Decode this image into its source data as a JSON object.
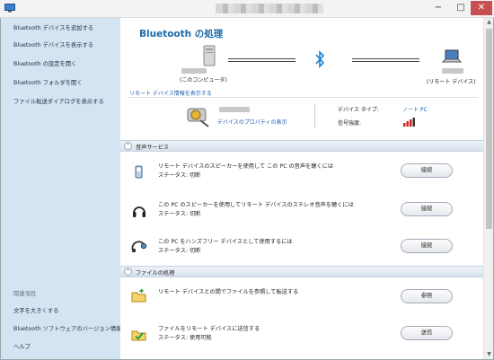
{
  "window": {
    "min_label": "−",
    "max_label": "□",
    "close_label": "✕"
  },
  "sidebar": {
    "tasks": [
      {
        "label": "Bluetooth デバイスを追加する"
      },
      {
        "label": "Bluetooth デバイスを表示する"
      },
      {
        "label": "Bluetooth の設定を開く"
      },
      {
        "label": "Bluetooth フォルダを開く"
      },
      {
        "label": "ファイル転送ダイアログを表示する"
      }
    ],
    "related_heading": "関連項目",
    "related": [
      {
        "label": "文字を大きくする"
      },
      {
        "label": "Bluetooth ソフトウェアのバージョン情報"
      },
      {
        "label": "ヘルプ"
      }
    ]
  },
  "main": {
    "title": "Bluetooth の処理",
    "this_computer_label": "(このコンピュータ)",
    "remote_device_label": "(リモート デバイス)",
    "remote_info_link": "リモート デバイス情報を表示する",
    "device_props_link": "デバイスのプロパティの表示",
    "device_type_label": "デバイス タイプ:",
    "device_type_value": "ノート PC",
    "signal_label": "信号強度:",
    "sections": [
      {
        "title": "音声サービス",
        "services": [
          {
            "text": "リモート デバイスのスピーカーを使用して この PC の音声を聴くには",
            "status": "ステータス:  切断",
            "button": "接続",
            "icon": "speaker-phone-icon"
          },
          {
            "text": "この PC のスピーカーを使用してリモート デバイスのステレオ音声を聴くには",
            "status": "ステータス:  切断",
            "button": "接続",
            "icon": "headphones-icon"
          },
          {
            "text": "この PC をハンズフリー デバイスとして使用するには",
            "status": "ステータス:  切断",
            "button": "接続",
            "icon": "headset-icon"
          }
        ]
      },
      {
        "title": "ファイルの処理",
        "services": [
          {
            "text": "リモート デバイスとの間でファイルを参照して転送する",
            "status": "",
            "button": "参照",
            "icon": "folder-browse-icon"
          },
          {
            "text": "ファイルをリモート デバイスに送信する",
            "status": "ステータス:  使用可能",
            "button": "送信",
            "icon": "folder-send-icon"
          }
        ]
      }
    ]
  },
  "colors": {
    "title_blue": "#1c6aa8",
    "link_blue": "#1d5fb0",
    "sidebar_bg": "#d3e4f3",
    "close_red": "#c75050"
  }
}
